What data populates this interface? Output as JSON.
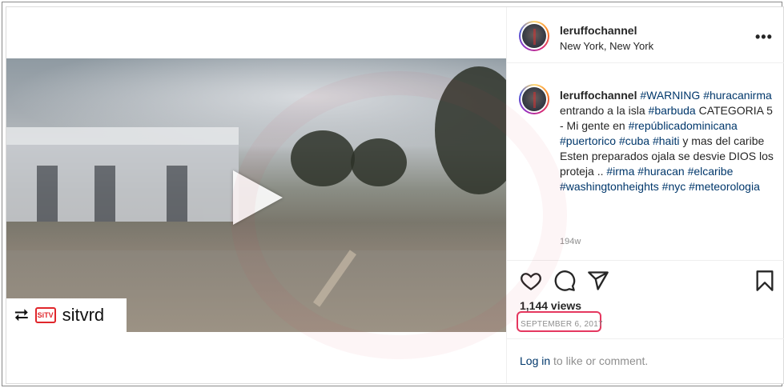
{
  "post": {
    "username": "leruffochannel",
    "location": "New York, New York",
    "more_label": "•••",
    "caption_parts": [
      {
        "text": "#WARNING",
        "tag": true
      },
      {
        "text": " ",
        "tag": false
      },
      {
        "text": "#huracanirma",
        "tag": true
      },
      {
        "text": " entrando a la isla ",
        "tag": false
      },
      {
        "text": "#barbuda",
        "tag": true
      },
      {
        "text": " CATEGORIA 5 - Mi gente en ",
        "tag": false
      },
      {
        "text": "#repúblicadominicana",
        "tag": true
      },
      {
        "text": " ",
        "tag": false
      },
      {
        "text": "#puertorico",
        "tag": true
      },
      {
        "text": " ",
        "tag": false
      },
      {
        "text": "#cuba",
        "tag": true
      },
      {
        "text": " ",
        "tag": false
      },
      {
        "text": "#haiti",
        "tag": true
      },
      {
        "text": " y mas del caribe Esten preparados ojala se desvie DIOS los proteja .. ",
        "tag": false
      },
      {
        "text": "#irma",
        "tag": true
      },
      {
        "text": " ",
        "tag": false
      },
      {
        "text": "#huracan",
        "tag": true
      },
      {
        "text": " ",
        "tag": false
      },
      {
        "text": "#elcaribe",
        "tag": true
      },
      {
        "text": " ",
        "tag": false
      },
      {
        "text": "#washingtonheights",
        "tag": true
      },
      {
        "text": " ",
        "tag": false
      },
      {
        "text": "#nyc",
        "tag": true
      },
      {
        "text": " ",
        "tag": false
      },
      {
        "text": "#meteorologia",
        "tag": true
      }
    ],
    "time_ago": "194w",
    "views": "1,144 views",
    "date": "SEPTEMBER 6, 2017",
    "login_link": "Log in",
    "login_rest": " to like or comment."
  },
  "video": {
    "repost_icon": "repost-icon",
    "repost_logo_text": "SiTV",
    "repost_name": "sitvrd"
  },
  "colors": {
    "link": "#00376b",
    "highlight_box": "#e5375f"
  }
}
